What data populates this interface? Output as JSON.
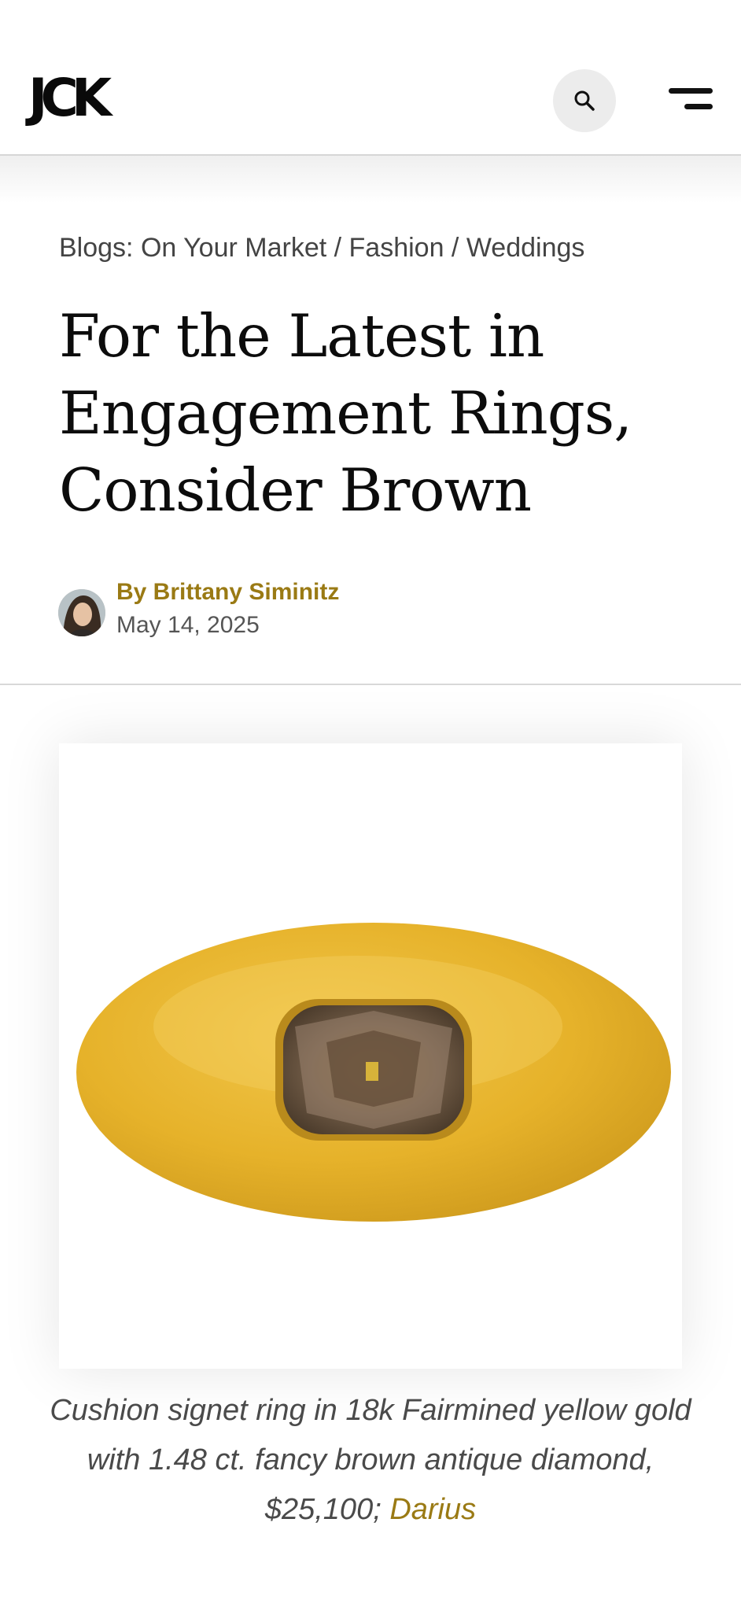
{
  "header": {
    "logo": "JCK",
    "search_icon": "search-icon",
    "menu_icon": "menu-icon"
  },
  "article": {
    "breadcrumb": "Blogs: On Your Market / Fashion / Weddings",
    "title": "For the Latest in Engagement Rings, Consider Brown",
    "author": "By Brittany Siminitz",
    "date": "May 14, 2025",
    "caption_text": "Cushion signet ring in 18k Fairmined yellow gold with 1.48 ct. fancy brown antique diamond, $25,100; ",
    "caption_link": "Darius"
  },
  "colors": {
    "accent": "#9a7a14",
    "text": "#0c0c0c",
    "muted": "#555555"
  }
}
